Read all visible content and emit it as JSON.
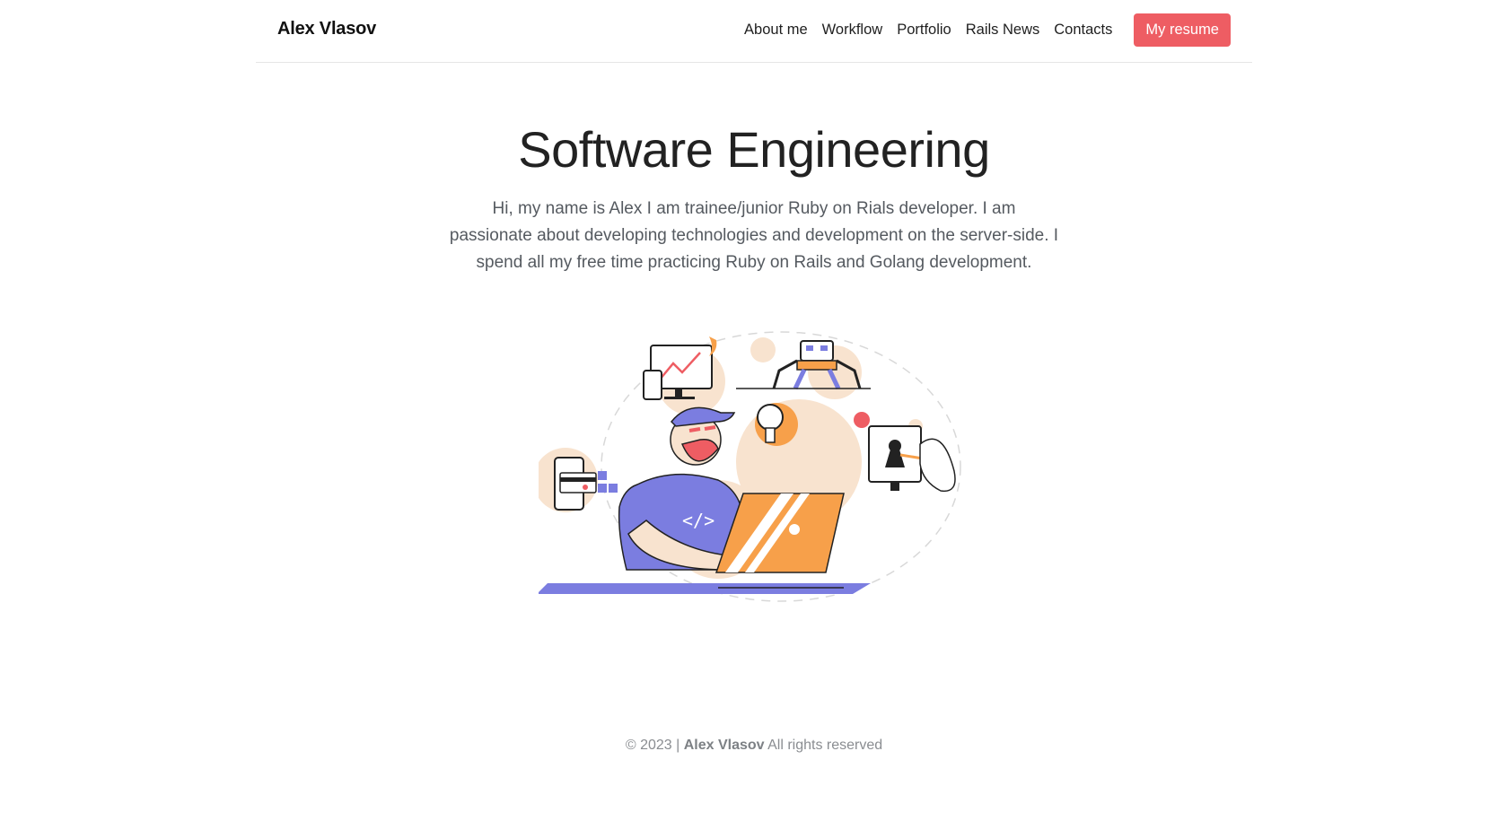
{
  "header": {
    "brand": "Alex Vlasov",
    "nav": [
      {
        "label": "About me"
      },
      {
        "label": "Workflow"
      },
      {
        "label": "Portfolio"
      },
      {
        "label": "Rails News"
      },
      {
        "label": "Contacts"
      }
    ],
    "resume_label": "My resume"
  },
  "hero": {
    "title": "Software Engineering",
    "lead": "Hi, my name is Alex I am trainee/junior Ruby on Rials developer. I am passionate about developing technologies and development on the server-side. I spend all my free time practicing Ruby on Rails and Golang development.",
    "illustration_code_text": "</>"
  },
  "footer": {
    "prefix": "© 2023 |",
    "name": "Alex Vlasov",
    "suffix": "All rights reserved"
  },
  "colors": {
    "accent": "#ee5d63",
    "purple": "#7b7de0",
    "orange": "#f7a04a",
    "peach": "#f8e3cf"
  }
}
